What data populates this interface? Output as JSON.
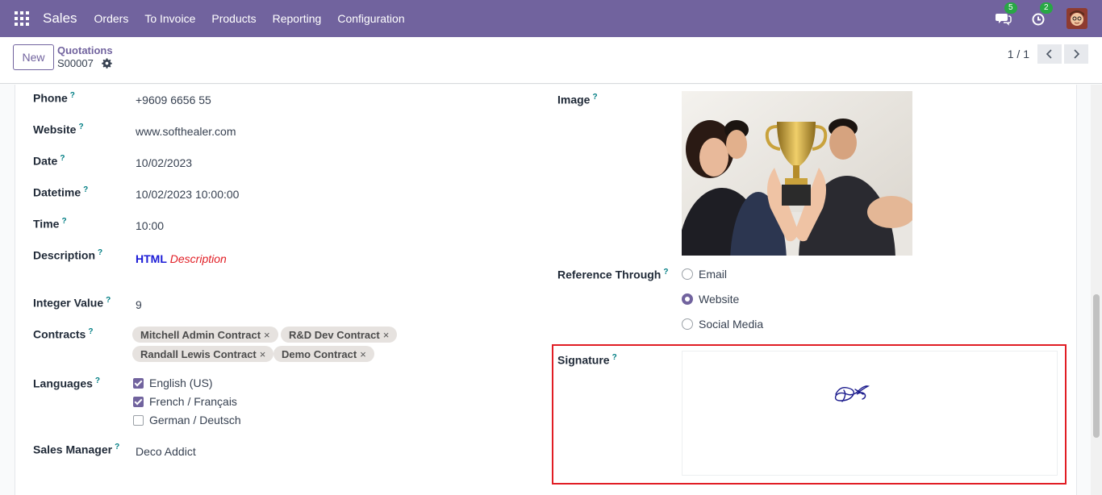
{
  "navbar": {
    "app_name": "Sales",
    "menu": [
      "Orders",
      "To Invoice",
      "Products",
      "Reporting",
      "Configuration"
    ],
    "messages_badge": "5",
    "activities_badge": "2",
    "color": "#71639e"
  },
  "control": {
    "new_label": "New",
    "breadcrumb_parent": "Quotations",
    "breadcrumb_current": "S00007",
    "pager": "1 / 1"
  },
  "form": {
    "help_mark": "?",
    "phone": {
      "label": "Phone",
      "value": "+9609 6656 55"
    },
    "website": {
      "label": "Website",
      "value": "www.softhealer.com"
    },
    "date": {
      "label": "Date",
      "value": "10/02/2023"
    },
    "datetime": {
      "label": "Datetime",
      "value": "10/02/2023 10:00:00"
    },
    "time": {
      "label": "Time",
      "value": "10:00"
    },
    "description": {
      "label": "Description",
      "bold_part": "HTML",
      "italic_part": "Description"
    },
    "integer": {
      "label": "Integer Value",
      "value": "9"
    },
    "contracts": {
      "label": "Contracts",
      "tags": [
        "Mitchell Admin Contract",
        "R&D Dev Contract",
        "Randall Lewis Contract",
        "Demo Contract"
      ],
      "remove_glyph": "×"
    },
    "languages": {
      "label": "Languages",
      "options": [
        {
          "label": "English (US)",
          "checked": true
        },
        {
          "label": "French / Français",
          "checked": true
        },
        {
          "label": "German / Deutsch",
          "checked": false
        }
      ]
    },
    "sales_manager": {
      "label": "Sales Manager",
      "value": "Deco Addict"
    },
    "image": {
      "label": "Image"
    },
    "reference": {
      "label": "Reference Through",
      "options": [
        {
          "label": "Email",
          "selected": false
        },
        {
          "label": "Website",
          "selected": true
        },
        {
          "label": "Social Media",
          "selected": false
        }
      ]
    },
    "signature": {
      "label": "Signature"
    }
  }
}
